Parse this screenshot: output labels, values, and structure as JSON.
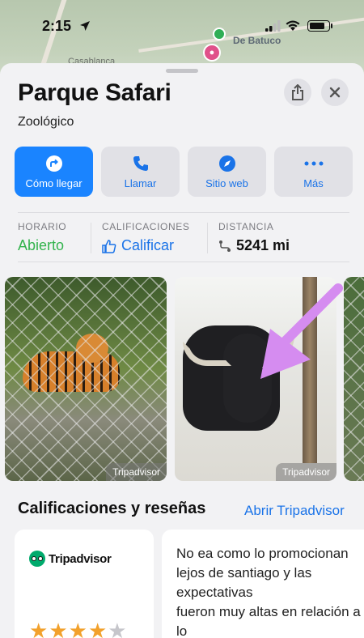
{
  "status_bar": {
    "time": "2:15"
  },
  "map": {
    "town_label": "De Batuco",
    "casa_label": "Casablanca"
  },
  "place": {
    "name": "Parque Safari",
    "category": "Zoológico"
  },
  "actions": [
    {
      "label": "Cómo llegar",
      "icon": "directions-icon"
    },
    {
      "label": "Llamar",
      "icon": "phone-icon"
    },
    {
      "label": "Sitio web",
      "icon": "compass-icon"
    },
    {
      "label": "Más",
      "icon": "more-icon"
    }
  ],
  "info": {
    "hours_label": "HORARIO",
    "hours_value": "Abierto",
    "ratings_label": "CALIFICACIONES",
    "ratings_value": "Calificar",
    "distance_label": "DISTANCIA",
    "distance_value": "5241 mi"
  },
  "photos": [
    {
      "credit": "Tripadvisor"
    },
    {
      "credit": "Tripadvisor"
    }
  ],
  "ratings_section": {
    "title": "Calificaciones y reseñas",
    "link": "Abrir Tripadvisor",
    "provider": "Tripadvisor",
    "stars_filled": 4,
    "stars_total": 5,
    "review_text": "No ea como lo promocionan\nlejos de santiago y las expectativas\nfueron muy altas en relación a lo\nvivido. El tour en media hora"
  },
  "colors": {
    "accent": "#1a84ff",
    "link": "#1a73e8",
    "open_green": "#33b34d",
    "annotation_arrow": "#d58cf0"
  }
}
